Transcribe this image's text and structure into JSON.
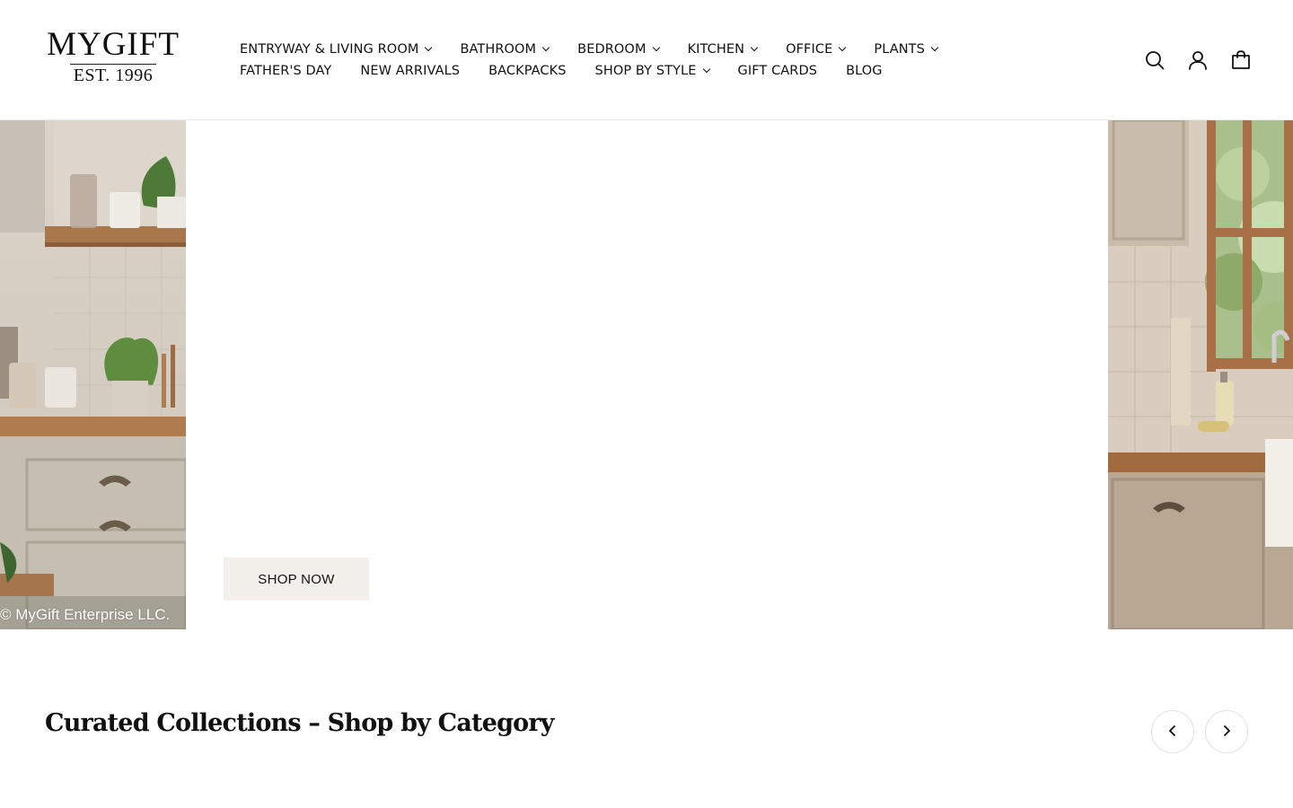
{
  "brand": {
    "name": "MYGIFT",
    "established": "EST. 1996"
  },
  "nav": {
    "row1": [
      {
        "label": "ENTRYWAY & LIVING ROOM",
        "dropdown": true
      },
      {
        "label": "BATHROOM",
        "dropdown": true
      },
      {
        "label": "BEDROOM",
        "dropdown": true
      },
      {
        "label": "KITCHEN",
        "dropdown": true
      },
      {
        "label": "OFFICE",
        "dropdown": true
      },
      {
        "label": "PLANTS",
        "dropdown": true
      }
    ],
    "row2": [
      {
        "label": "FATHER'S DAY",
        "dropdown": false
      },
      {
        "label": "NEW ARRIVALS",
        "dropdown": false
      },
      {
        "label": "BACKPACKS",
        "dropdown": false
      },
      {
        "label": "SHOP BY STYLE",
        "dropdown": true
      },
      {
        "label": "GIFT CARDS",
        "dropdown": false
      },
      {
        "label": "BLOG",
        "dropdown": false
      }
    ]
  },
  "header_icons": [
    "search-icon",
    "account-icon",
    "cart-icon"
  ],
  "hero": {
    "cta_label": "SHOP NOW",
    "copyright": "© MyGift Enterprise LLC."
  },
  "collections": {
    "title": "Curated Collections – Shop by Category",
    "prev_icon": "chevron-left-icon",
    "next_icon": "chevron-right-icon"
  },
  "colors": {
    "text": "#111111",
    "cta_background": "#f3f0ec",
    "border": "#e1e1e1"
  }
}
